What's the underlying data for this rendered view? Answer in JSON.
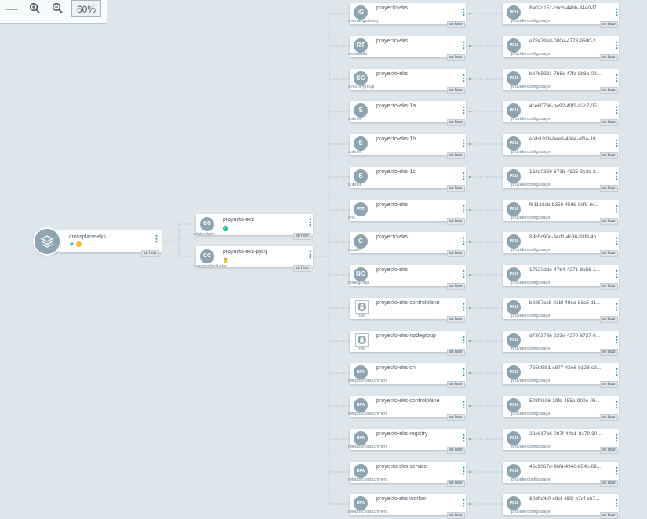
{
  "toolbar": {
    "zoom_level": "60%",
    "fit_icon": "minus-icon",
    "zoom_in_icon": "zoom-in-icon",
    "zoom_out_icon": "zoom-out-icon"
  },
  "colors": {
    "background": "#dee6eb",
    "icon": "#8fa4b1",
    "accent": "#2a8fc7",
    "healthy": "#18be94",
    "progressing": "#f4c030",
    "edge": "#a3b2bc"
  },
  "root": {
    "name": "crossplane-eks",
    "age": "an hour",
    "health_icon": "heart-icon",
    "status_icon": "progressing-icon"
  },
  "mid": [
    {
      "abbr": "CC",
      "name": "proyecto-eks",
      "kind": "claimclaim",
      "age": "an hour",
      "status_icon": "check-circle-icon"
    },
    {
      "abbr": "CC",
      "name": "proyecto-eks-pjskj",
      "kind": "compositecluster",
      "age": "an hour",
      "status_icon": "trash-icon"
    }
  ],
  "resources": [
    {
      "abbr": "IG",
      "name": "proyecto-eks",
      "kind": "internetgateway",
      "age": "an hour",
      "pcu": "8a02d151-cbcb-44bb-84e0-f7..."
    },
    {
      "abbr": "RT",
      "name": "proyecto-eks",
      "kind": "routetable",
      "age": "an hour",
      "pcu": "e78479e8-080e-4778-9500-2..."
    },
    {
      "abbr": "SG",
      "name": "proyecto-eks",
      "kind": "securitygroup",
      "age": "an hour",
      "pcu": "bb7b5931-7b8c-47fc-8b8a-09..."
    },
    {
      "abbr": "S",
      "name": "proyecto-eks-1a",
      "kind": "subnet",
      "age": "an hour",
      "pcu": "4ce60796-be92-49f3-82c7-05..."
    },
    {
      "abbr": "S",
      "name": "proyecto-eks-1b",
      "kind": "subnet",
      "age": "an hour",
      "pcu": "efab191b-6ee8-4604-af6a-18..."
    },
    {
      "abbr": "S",
      "name": "proyecto-eks-1c",
      "kind": "subnet",
      "age": "an hour",
      "pcu": "162d0359-673b-4825-9e2d-2..."
    },
    {
      "abbr": "VPC",
      "name": "proyecto-eks",
      "kind": "vpc",
      "age": "an hour",
      "pcu": "f61133eb-b356-459b-9cf8-6c..."
    },
    {
      "abbr": "C",
      "name": "proyecto-eks",
      "kind": "cluster",
      "age": "an hour",
      "pcu": "89b5c90c-34d1-4c98-83f8-4b..."
    },
    {
      "abbr": "NG",
      "name": "proyecto-eks",
      "kind": "nodegroup",
      "age": "an hour",
      "pcu": "17520dde-47b4-4271-8b56-1..."
    },
    {
      "abbr": "",
      "name": "proyecto-eks-controlplane",
      "kind": "role",
      "age": "an hour",
      "pcu": "b9257cc6-03bf-49ea-83c5-d1..."
    },
    {
      "abbr": "",
      "name": "proyecto-eks-nodegroup",
      "kind": "role",
      "age": "an hour",
      "pcu": "d730378b-233e-4270-8727-0..."
    },
    {
      "abbr": "RPA",
      "name": "proyecto-eks-cni",
      "kind": "rolepolicyattachment",
      "age": "an hour",
      "pcu": "755bf381-c877-42e6-b128-c9..."
    },
    {
      "abbr": "RPA",
      "name": "proyecto-eks-controlplane",
      "kind": "rolepolicyattachment",
      "age": "an hour",
      "pcu": "508f9196-19fd-455a-900e-05..."
    },
    {
      "abbr": "RPA",
      "name": "proyecto-eks-registry",
      "kind": "rolepolicyattachment",
      "age": "an hour",
      "pcu": "22e617b6-087f-44b1-8a79-30..."
    },
    {
      "abbr": "RPA",
      "name": "proyecto-eks-service",
      "kind": "rolepolicyattachment",
      "age": "an hour",
      "pcu": "46c9067d-9bfd-4940-b54c-89..."
    },
    {
      "abbr": "RPA",
      "name": "proyecto-eks-worker",
      "kind": "rolepolicyattachment",
      "age": "an hour",
      "pcu": "82dfa0b0-e9cf-45f2-b7ef-c67..."
    }
  ],
  "pcu": {
    "abbr": "PCU",
    "kind": "providerconfigusage",
    "age": "an hour"
  }
}
